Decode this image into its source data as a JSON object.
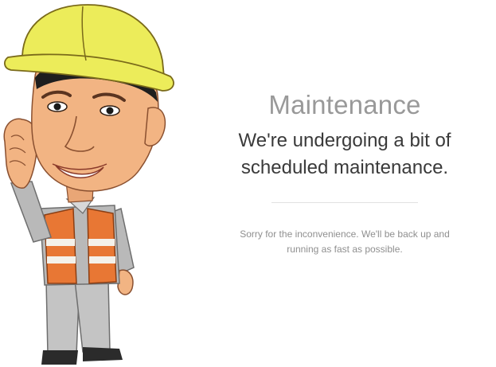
{
  "maintenance": {
    "title": "Maintenance",
    "headline": "We're undergoing a bit of scheduled maintenance.",
    "message": "Sorry for the inconvenience. We'll be back up and running as fast as possible."
  },
  "illustration": {
    "icon": "construction-worker-illustration",
    "colors": {
      "helmet": "#ecec5a",
      "skin": "#f2b483",
      "vest": "#e87734",
      "reflective_stripe": "#f4f1ea",
      "shirt": "#b9b9b9",
      "pants": "#c4c4c4",
      "shoes": "#2b2b2b",
      "hair": "#1e1e1e"
    }
  }
}
